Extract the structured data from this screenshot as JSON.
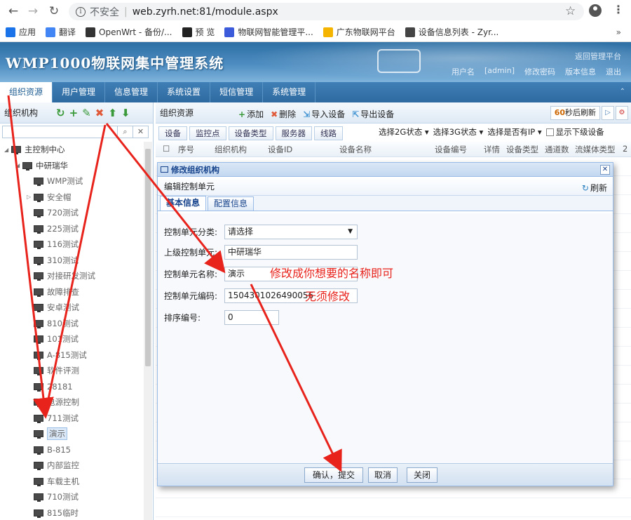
{
  "browser": {
    "insecure_label": "不安全",
    "url": "web.zyrh.net:81/module.aspx",
    "bookmarks": [
      {
        "label": "应用",
        "icon": "apps-icon",
        "color": "#1a73e8"
      },
      {
        "label": "翻译",
        "icon": "translate-icon",
        "color": "#4285f4"
      },
      {
        "label": "OpenWrt - 备份/...",
        "icon": "openwrt-icon",
        "color": "#333333"
      },
      {
        "label": "预 览",
        "icon": "preview-icon",
        "color": "#222222"
      },
      {
        "label": "物联网智能管理平...",
        "icon": "iot-icon",
        "color": "#3b5bdb"
      },
      {
        "label": "广东物联网平台",
        "icon": "platform-icon",
        "color": "#f4b400"
      },
      {
        "label": "设备信息列表 - Zyr...",
        "icon": "globe-icon",
        "color": "#444444"
      }
    ],
    "more": "»"
  },
  "header": {
    "title": "WMP1000物联网集中管理系统",
    "top_link": "返回管理平台",
    "user_label": "用户名",
    "user": "[admin]",
    "change_password": "修改密码",
    "version": "版本信息",
    "logout": "退出"
  },
  "nav": {
    "items": [
      "组织资源",
      "用户管理",
      "信息管理",
      "系统设置",
      "短信管理",
      "系统管理"
    ],
    "active": 0
  },
  "left_panel": {
    "title": "组织机构",
    "tree": [
      {
        "label": "主控制中心",
        "level": 0,
        "expanded": true
      },
      {
        "label": "中研瑞华",
        "level": 1,
        "expanded": true
      },
      {
        "label": "WMP测试",
        "level": 2
      },
      {
        "label": "安全帽",
        "level": 2,
        "collapsed": true
      },
      {
        "label": "720测试",
        "level": 2
      },
      {
        "label": "225测试",
        "level": 2
      },
      {
        "label": "116测试",
        "level": 2
      },
      {
        "label": "310测试",
        "level": 2
      },
      {
        "label": "对接研发测试",
        "level": 2
      },
      {
        "label": "故障排查",
        "level": 2
      },
      {
        "label": "安卓测试",
        "level": 2
      },
      {
        "label": "810测试",
        "level": 2
      },
      {
        "label": "101测试",
        "level": 2
      },
      {
        "label": "A-815测试",
        "level": 2
      },
      {
        "label": "软件评测",
        "level": 2
      },
      {
        "label": "28181",
        "level": 2
      },
      {
        "label": "电源控制",
        "level": 2
      },
      {
        "label": "711测试",
        "level": 2
      },
      {
        "label": "演示",
        "level": 2,
        "selected": true
      },
      {
        "label": "B-815",
        "level": 2
      },
      {
        "label": "内部监控",
        "level": 2
      },
      {
        "label": "车载主机",
        "level": 2
      },
      {
        "label": "710测试",
        "level": 2
      },
      {
        "label": "815临时",
        "level": 2
      }
    ]
  },
  "right_panel": {
    "title": "组织资源",
    "actions": [
      {
        "label": "添加",
        "icon": "add-icon"
      },
      {
        "label": "删除",
        "icon": "delete-icon"
      },
      {
        "label": "导入设备",
        "icon": "import-icon"
      },
      {
        "label": "导出设备",
        "icon": "export-icon"
      }
    ],
    "refresh_seconds": "60",
    "refresh_suffix": "秒后刷新",
    "tabs": [
      "设备",
      "监控点",
      "设备类型",
      "服务器",
      "线路"
    ],
    "filters": [
      "选择2G状态",
      "选择3G状态",
      "选择是否有IP"
    ],
    "show_sub_label": "显示下级设备",
    "columns": [
      "序号",
      "组织机构",
      "设备ID",
      "设备名称",
      "设备编号",
      "详情",
      "设备类型",
      "通道数",
      "流媒体类型",
      "2"
    ]
  },
  "modal": {
    "title": "修改组织机构",
    "subtitle": "编辑控制单元",
    "refresh_label": "刷新",
    "tabs": [
      "基本信息",
      "配置信息"
    ],
    "fields": {
      "category_label": "控制单元分类:",
      "category_value": "请选择",
      "parent_label": "上级控制单元:",
      "parent_value": "中研瑞华",
      "name_label": "控制单元名称:",
      "name_value": "演示",
      "code_label": "控制单元编码:",
      "code_value": "1504301026490056",
      "order_label": "排序编号:",
      "order_value": "0"
    },
    "annotations": {
      "name_hint": "修改成你想要的名称即可",
      "code_hint": "无须修改"
    },
    "buttons": {
      "confirm": "确认，提交",
      "cancel": "取消",
      "close": "关闭"
    }
  },
  "colors": {
    "annotation_red": "#e8231c",
    "header_blue": "#2d6fa4"
  }
}
